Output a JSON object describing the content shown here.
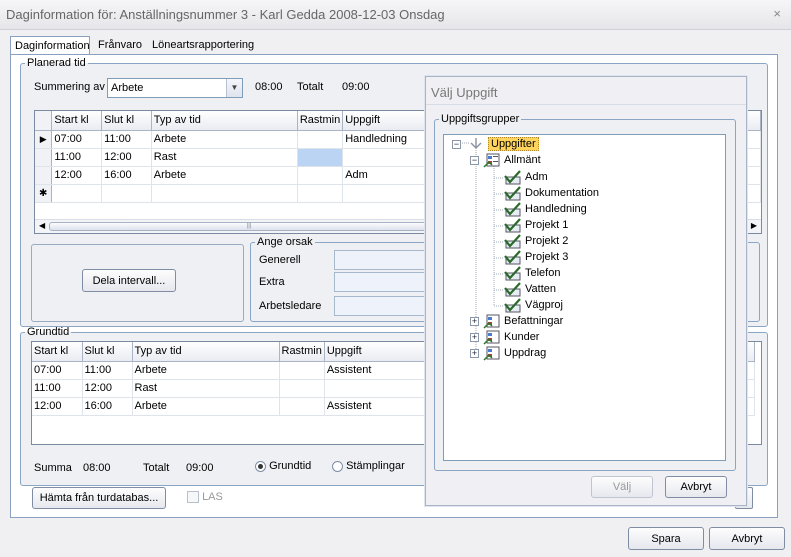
{
  "window": {
    "title": "Daginformation för: Anställningsnummer 3 -  Karl Gedda 2008-12-03 Onsdag",
    "close_glyph": "×"
  },
  "tabs": [
    {
      "label": "Daginformation"
    },
    {
      "label": "Frånvaro"
    },
    {
      "label": "Löneartsrapportering"
    }
  ],
  "planerad": {
    "legend": "Planerad tid",
    "summering_label": "Summering av",
    "summering_value": "Arbete",
    "sum_time": "08:00",
    "totalt_label": "Totalt",
    "totalt_value": "09:00",
    "columns": [
      "Start kl",
      "Slut kl",
      "Typ av tid",
      "Rastmin",
      "Uppgift"
    ],
    "rows": [
      {
        "start": "07:00",
        "slut": "11:00",
        "typ": "Arbete",
        "rast": "",
        "uppgift": "Handledning"
      },
      {
        "start": "11:00",
        "slut": "12:00",
        "typ": "Rast",
        "rast": "",
        "uppgift": ""
      },
      {
        "start": "12:00",
        "slut": "16:00",
        "typ": "Arbete",
        "rast": "",
        "uppgift": "Adm"
      }
    ],
    "new_row_glyph": "✱",
    "current_row_glyph": "▶",
    "scroll_thumb_glyph": "|||"
  },
  "dela_button": "Dela intervall...",
  "orsak": {
    "legend": "Ange orsak",
    "fields": [
      "Generell",
      "Extra",
      "Arbetsledare"
    ]
  },
  "grundtid": {
    "legend": "Grundtid",
    "columns": [
      "Start kl",
      "Slut kl",
      "Typ av tid",
      "Rastmin",
      "Uppgift"
    ],
    "rows": [
      {
        "start": "07:00",
        "slut": "11:00",
        "typ": "Arbete",
        "rast": "",
        "uppgift": "Assistent"
      },
      {
        "start": "11:00",
        "slut": "12:00",
        "typ": "Rast",
        "rast": "",
        "uppgift": ""
      },
      {
        "start": "12:00",
        "slut": "16:00",
        "typ": "Arbete",
        "rast": "",
        "uppgift": "Assistent"
      }
    ]
  },
  "summary": {
    "summa_label": "Summa",
    "summa_value": "08:00",
    "totalt_label": "Totalt",
    "totalt_value": "09:00",
    "radio_grundtid": "Grundtid",
    "radio_stamplingar": "Stämplingar",
    "selected": "Grundtid"
  },
  "hamta_button": "Hämta från turdatabas...",
  "las_label": "LAS",
  "footer": {
    "spara": "Spara",
    "avbryt": "Avbryt"
  },
  "dialog": {
    "title": "Välj Uppgift",
    "legend": "Uppgiftsgrupper",
    "root": "Uppgifter",
    "groups": [
      {
        "label": "Allmänt",
        "expanded": true,
        "items": [
          "Adm",
          "Dokumentation",
          "Handledning",
          "Projekt 1",
          "Projekt 2",
          "Projekt 3",
          "Telefon",
          "Vatten",
          "Vägproj"
        ]
      },
      {
        "label": "Befattningar",
        "expanded": false
      },
      {
        "label": "Kunder",
        "expanded": false
      },
      {
        "label": "Uppdrag",
        "expanded": false
      }
    ],
    "valj": "Välj",
    "avbryt": "Avbryt",
    "expander_open": "−",
    "expander_closed": "+",
    "root_selected_color": "#ffd35c"
  }
}
